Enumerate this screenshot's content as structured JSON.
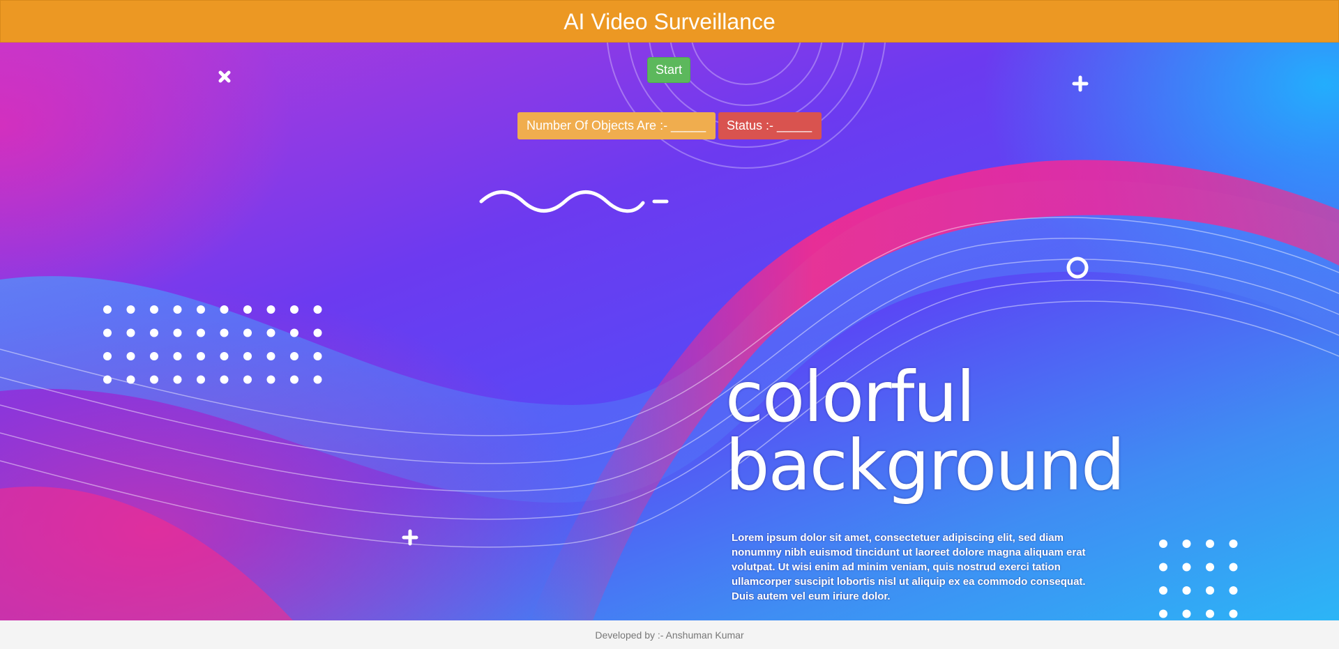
{
  "header": {
    "title": "AI Video Surveillance"
  },
  "controls": {
    "start_label": "Start",
    "objects_label": "Number Of Objects Are :- _____",
    "status_label": "Status :- _____"
  },
  "background_art": {
    "headline_line1": "colorful",
    "headline_line2": "background",
    "body_text": "Lorem ipsum dolor sit amet, consectetuer adipiscing elit, sed diam nonummy nibh euismod tincidunt ut laoreet dolore magna aliquam erat volutpat. Ut wisi enim ad minim veniam, quis nostrud exerci tation ullamcorper suscipit lobortis nisl ut aliquip ex ea commodo consequat. Duis autem vel eum iriure dolor.",
    "icons": [
      "x-mark-icon",
      "plus-icon",
      "plus-icon",
      "ring-icon",
      "wavy-line-icon",
      "dot-grid-icon",
      "dot-grid-icon"
    ]
  },
  "colors": {
    "header": "#ec9823",
    "start_button": "#5cb85c",
    "objects_badge": "#f0ad4e",
    "status_badge": "#d9534f",
    "footer_bg": "#f4f4f4"
  },
  "footer": {
    "text": "Developed by :- Anshuman Kumar"
  }
}
